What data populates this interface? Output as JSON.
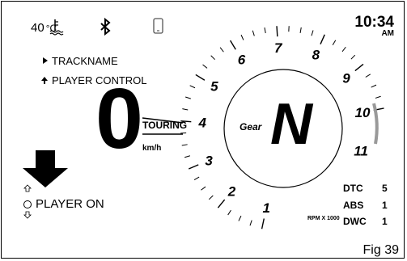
{
  "status_bar": {
    "temperature": "40",
    "temp_unit": "°C",
    "icons": [
      "coolant-temp-icon",
      "bluetooth-icon",
      "phone-icon"
    ]
  },
  "clock": {
    "time": "10:34",
    "ampm": "AM"
  },
  "menu": {
    "items": [
      {
        "icon": "play-arrow-icon",
        "label": "TRACKNAME"
      },
      {
        "icon": "up-arrow-icon",
        "label": "PLAYER CONTROL"
      }
    ]
  },
  "speed": {
    "value": "0",
    "unit": "km/h",
    "mode": "TOURING"
  },
  "gear": {
    "label": "Gear",
    "value": "N"
  },
  "tachometer": {
    "numbers": [
      "1",
      "2",
      "3",
      "4",
      "5",
      "6",
      "7",
      "8",
      "9",
      "10",
      "11"
    ],
    "unit_label": "RPM X 1000"
  },
  "player": {
    "label": "PLAYER ON"
  },
  "settings": [
    {
      "name": "DTC",
      "value": "5"
    },
    {
      "name": "ABS",
      "value": "1"
    },
    {
      "name": "DWC",
      "value": "1"
    }
  ],
  "figure_label": "Fig 39"
}
